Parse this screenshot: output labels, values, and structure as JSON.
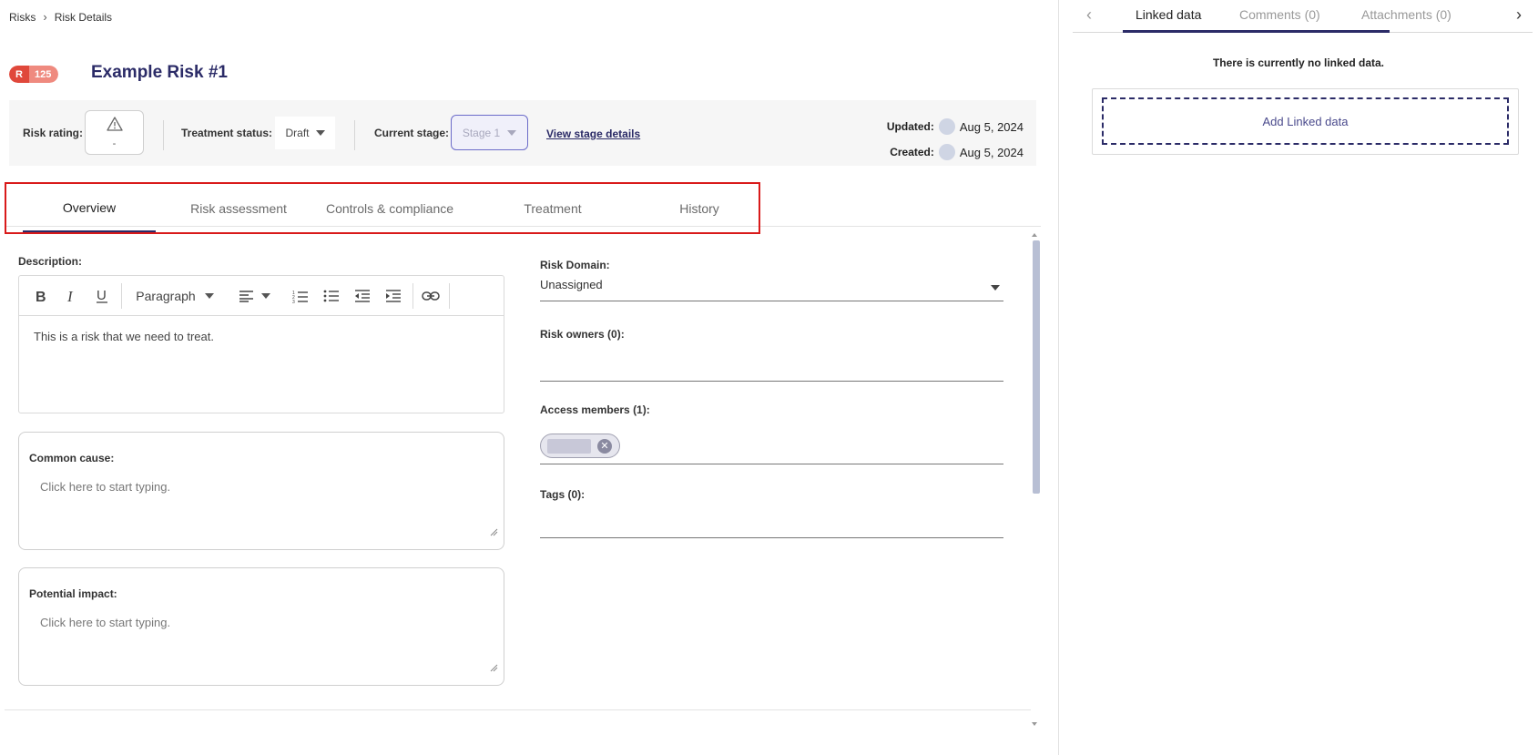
{
  "breadcrumb": {
    "root": "Risks",
    "current": "Risk Details"
  },
  "risk": {
    "badge_letter": "R",
    "badge_number": "125",
    "title": "Example Risk #1"
  },
  "infobar": {
    "risk_rating_label": "Risk rating:",
    "risk_rating_value": "-",
    "treatment_status_label": "Treatment status:",
    "treatment_status_value": "Draft",
    "current_stage_label": "Current stage:",
    "current_stage_value": "Stage 1",
    "view_stage_link": "View stage details",
    "updated_label": "Updated:",
    "updated_date": "Aug 5, 2024",
    "created_label": "Created:",
    "created_date": "Aug 5, 2024"
  },
  "tabs": [
    {
      "label": "Overview",
      "active": true
    },
    {
      "label": "Risk assessment",
      "active": false
    },
    {
      "label": "Controls & compliance",
      "active": false
    },
    {
      "label": "Treatment",
      "active": false
    },
    {
      "label": "History",
      "active": false
    }
  ],
  "description": {
    "label": "Description:",
    "paragraph_style": "Paragraph",
    "text": "This is a risk that we need to treat."
  },
  "common_cause": {
    "label": "Common cause:",
    "placeholder": "Click here to start typing."
  },
  "potential_impact": {
    "label": "Potential impact:",
    "placeholder": "Click here to start typing."
  },
  "risk_domain": {
    "label": "Risk Domain:",
    "value": "Unassigned"
  },
  "risk_owners": {
    "label": "Risk owners (0):"
  },
  "access_members": {
    "label": "Access members (1):"
  },
  "tags": {
    "label": "Tags (0):"
  },
  "side_panel": {
    "tabs": [
      {
        "label": "Linked data",
        "active": true
      },
      {
        "label": "Comments (0)",
        "active": false
      },
      {
        "label": "Attachments (0)",
        "active": false
      }
    ],
    "empty_message": "There is currently no linked data.",
    "add_button": "Add Linked data"
  },
  "colors": {
    "accent": "#2b2b67",
    "badge_red": "#e0483b",
    "badge_salmon": "#ef8a7f",
    "highlight": "#d91a1a"
  }
}
